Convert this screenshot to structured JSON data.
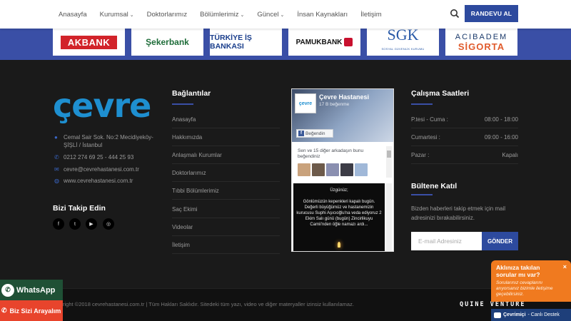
{
  "nav": {
    "items": [
      {
        "label": "Anasayfa",
        "dropdown": false
      },
      {
        "label": "Kurumsal",
        "dropdown": true
      },
      {
        "label": "Doktorlarımız",
        "dropdown": false
      },
      {
        "label": "Bölümlerimiz",
        "dropdown": true
      },
      {
        "label": "Güncel",
        "dropdown": true
      },
      {
        "label": "İnsan Kaynakları",
        "dropdown": false
      },
      {
        "label": "İletişim",
        "dropdown": false
      }
    ],
    "search_icon": "search-icon",
    "cta": "RANDEVU AL"
  },
  "partners": {
    "akbank": "AKBANK",
    "sekerbank": "Şekerbank",
    "isbank": "TÜRKİYE İŞ BANKASI",
    "pamukbank": "PAMUKBANK",
    "sgk": "SGK",
    "sgk_sub": "SOSYAL GÜVENLİK KURUMU",
    "acibadem_top": "ACIBADEM",
    "acibadem_bottom": "SİGORTA"
  },
  "brand": {
    "logo_text": "çevre",
    "address_line1": "Cemal Sair Sok. No:2 Mecidiyeköy-",
    "address_line2": "ŞİŞLİ / İstanbul",
    "phone": "0212 274 69 25 - 444 25 93",
    "email": "cevre@cevrehastanesi.com.tr",
    "website": "www.cevrehastanesi.com.tr",
    "follow_title": "Bizi Takip Edin",
    "social": [
      {
        "glyph": "f",
        "icon": "facebook-icon"
      },
      {
        "glyph": "t",
        "icon": "twitter-icon"
      },
      {
        "glyph": "▶",
        "icon": "youtube-icon"
      },
      {
        "glyph": "◎",
        "icon": "instagram-icon"
      }
    ]
  },
  "links": {
    "title": "Bağlantılar",
    "items": [
      "Anasayfa",
      "Hakkımızda",
      "Anlaşmalı Kurumlar",
      "Doktorlarımız",
      "Tıbbi Bölümlerimiz",
      "Saç Ekimi",
      "Videolar",
      "İletişim"
    ]
  },
  "facebook": {
    "page_name": "Çevre Hastanesi",
    "likes": "17 B beğenme",
    "thumb_text": "çevre",
    "like_button": "Beğendin",
    "friends_text": "Sen ve 15 diğer arkadaşın bunu beğendiniz",
    "post_title": "Üzgünüz;",
    "post_body": "Gönlümüzün kepenkleri kapalı bugün. Değerli büyüğümüz ve hastanemizin kurucusu Suphi Aşıcıoğlu'na veda ediyoruz 2 Ekim Salı günü (bugün) Zincirlikuyu Camii'nden öğle namazı ardı..."
  },
  "hours": {
    "title": "Çalışma Saatleri",
    "rows": [
      {
        "day": "P.tesi - Cuma :",
        "time": "08:00 - 18:00"
      },
      {
        "day": "Cumartesi :",
        "time": "09:00 - 16:00"
      },
      {
        "day": "Pazar :",
        "time": "Kapalı"
      }
    ]
  },
  "newsletter": {
    "title": "Bültene Katıl",
    "text": "Bizden haberleri takip etmek için mail adresinizi bırakabilirsiniz.",
    "placeholder": "E-mail Adresiniz",
    "button": "GÖNDER"
  },
  "footer": {
    "copyright": "right ©2018 cevrehastanesi.com.tr | Tüm Hakları Saklıdır. Sitedeki tüm yazı, video ve diğer materyaller izinsiz kullanılamaz.",
    "credit": "QUINE VENTURE"
  },
  "float": {
    "whatsapp": "WhatsApp",
    "callback": "Biz Sizi Arayalım"
  },
  "chat": {
    "title": "Aklınıza takılan sorular mı var?",
    "subtitle": "Sorularınız cevaplarını arıyorsanız bizimle iletişime geçebilirsiniz.",
    "close": "×",
    "status": "Çevrimiçi",
    "label": "- Canlı Destek"
  },
  "colors": {
    "brand_blue": "#2d4a9e",
    "logo_blue": "#1e8fd0",
    "chat_orange": "#f07a1f",
    "whatsapp_green": "#1f5035",
    "callback_red": "#e8442c"
  }
}
